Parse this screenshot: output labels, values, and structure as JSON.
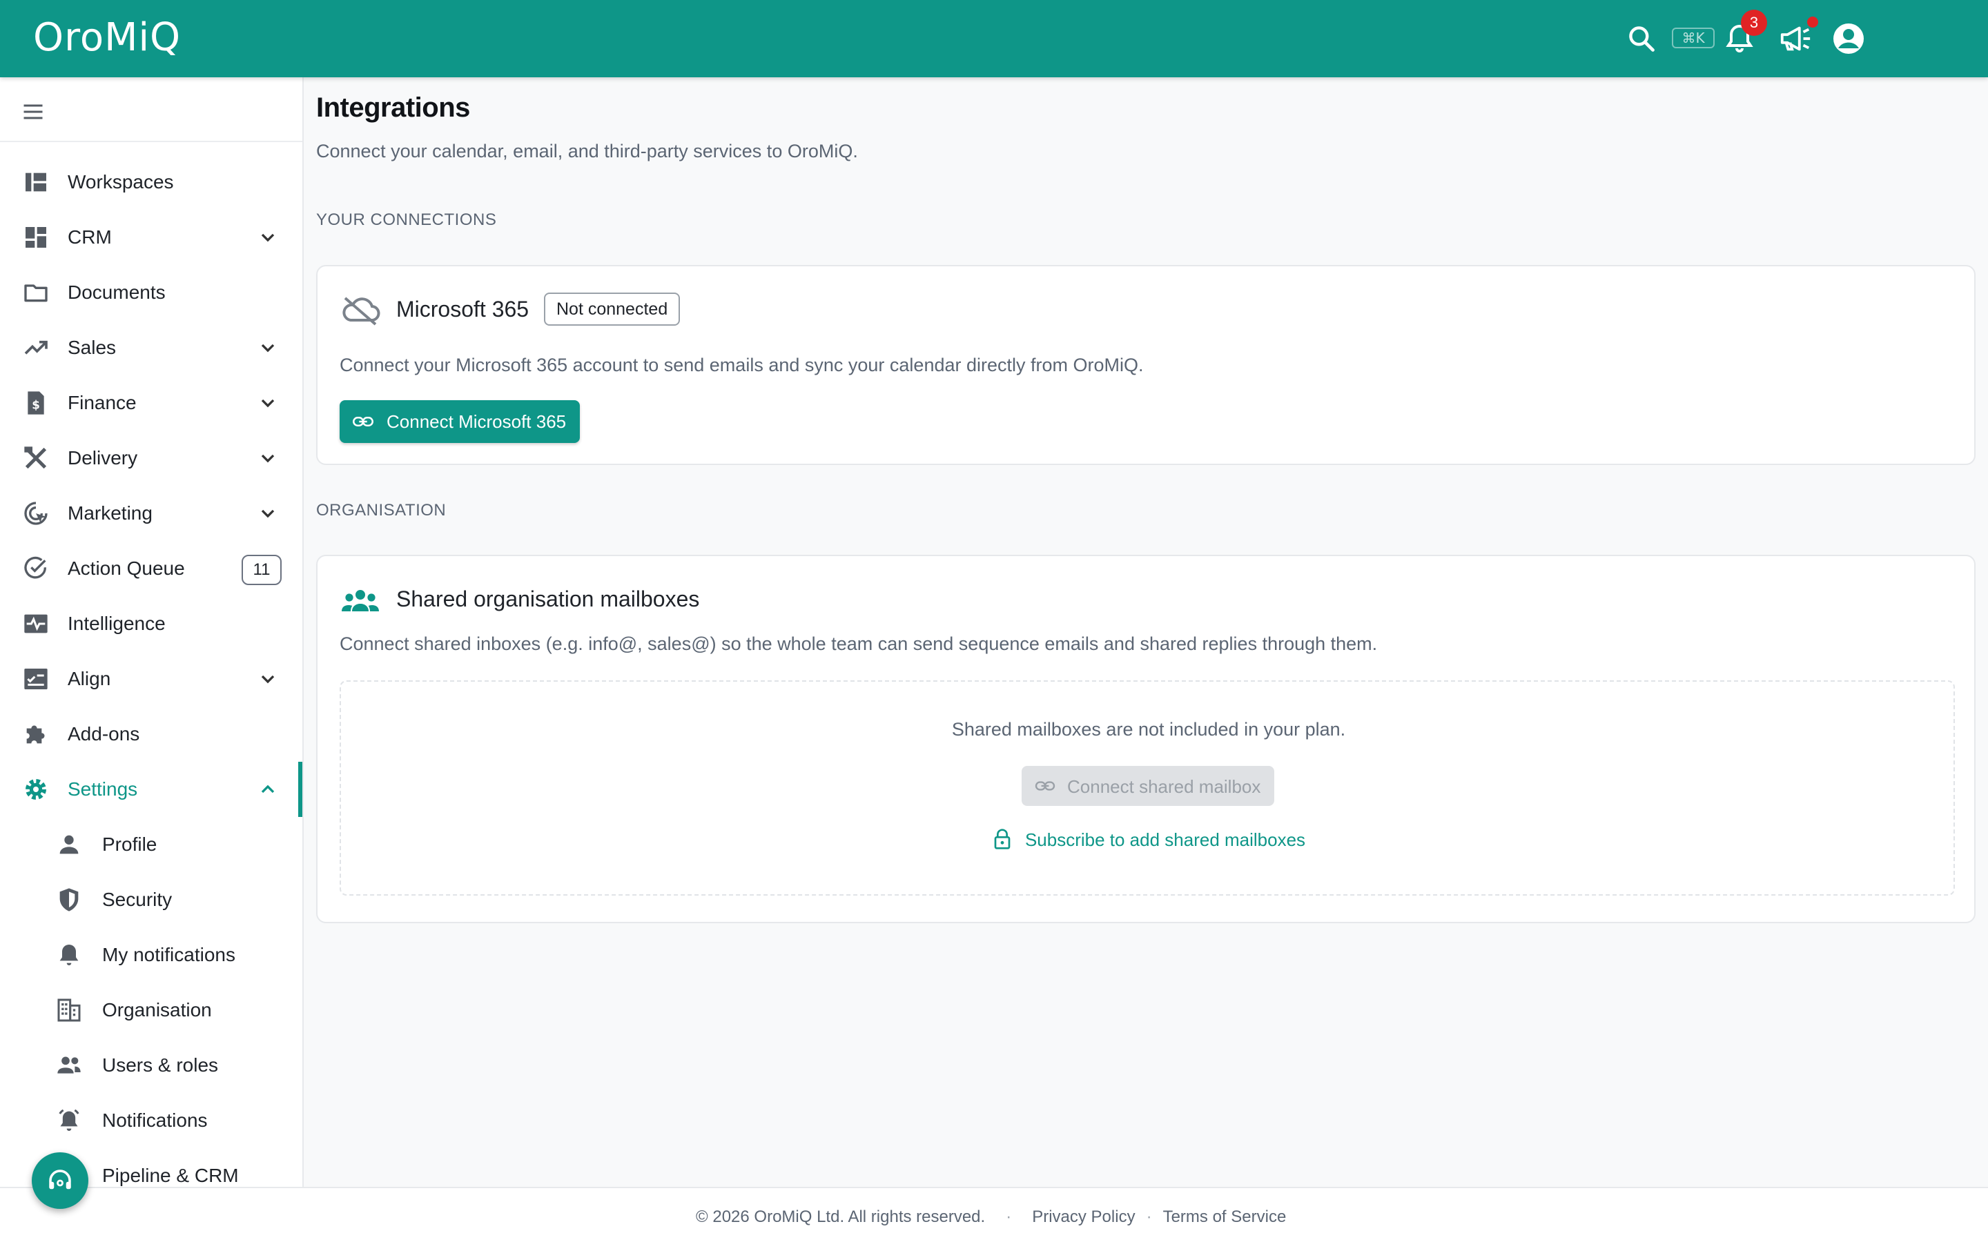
{
  "app": {
    "logo": "OroMiQ"
  },
  "topbar": {
    "shortcut_hint": "⌘K",
    "notification_count": "3"
  },
  "sidebar": {
    "items": [
      {
        "label": "Workspaces"
      },
      {
        "label": "CRM"
      },
      {
        "label": "Documents"
      },
      {
        "label": "Sales"
      },
      {
        "label": "Finance"
      },
      {
        "label": "Delivery"
      },
      {
        "label": "Marketing"
      },
      {
        "label": "Action Queue",
        "badge": "11"
      },
      {
        "label": "Intelligence"
      },
      {
        "label": "Align"
      },
      {
        "label": "Add-ons"
      },
      {
        "label": "Settings"
      }
    ],
    "settings_children": [
      {
        "label": "Profile"
      },
      {
        "label": "Security"
      },
      {
        "label": "My notifications"
      },
      {
        "label": "Organisation"
      },
      {
        "label": "Users & roles"
      },
      {
        "label": "Notifications"
      },
      {
        "label": "Pipeline & CRM"
      }
    ]
  },
  "main": {
    "title": "Integrations",
    "subtitle": "Connect your calendar, email, and third-party services to OroMiQ.",
    "sections": {
      "connections_label": "YOUR CONNECTIONS",
      "organisation_label": "ORGANISATION"
    },
    "microsoft": {
      "title": "Microsoft 365",
      "status": "Not connected",
      "description": "Connect your Microsoft 365 account to send emails and sync your calendar directly from OroMiQ.",
      "button": "Connect Microsoft 365"
    },
    "shared": {
      "title": "Shared organisation mailboxes",
      "description": "Connect shared inboxes (e.g. info@, sales@) so the whole team can send sequence emails and shared replies through them.",
      "empty_message": "Shared mailboxes are not included in your plan.",
      "button": "Connect shared mailbox",
      "subscribe_link": "Subscribe to add shared mailboxes"
    }
  },
  "footer": {
    "copyright": "© 2026 OroMiQ Ltd. All rights reserved.",
    "separator": "·",
    "privacy": "Privacy Policy",
    "terms": "Terms of Service"
  },
  "colors": {
    "brand": "#0e9688",
    "badge": "#e02424"
  }
}
